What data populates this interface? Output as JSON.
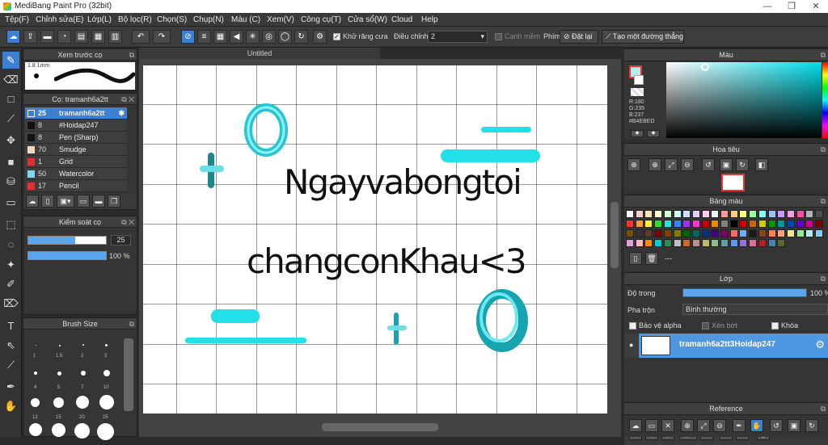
{
  "window": {
    "title": "MediBang Paint Pro (32bit)",
    "minimize": "—",
    "restore": "❐",
    "close": "✕"
  },
  "menu": [
    "Tệp(F)",
    "Chỉnh sửa(E)",
    "Lớp(L)",
    "Bộ lọc(R)",
    "Chọn(S)",
    "Chụp(N)",
    "Màu (C)",
    "Xem(V)",
    "Công cụ(T)",
    "Cửa sổ(W)",
    "Cloud",
    "Help"
  ],
  "toolbar": {
    "antialias": "Khử răng cưa",
    "adjust_label": "Điều chỉnh",
    "adjust_value": "2",
    "edge_snap": "Cạnh mềm",
    "snap_label": "Phím",
    "reset": "Đặt lại",
    "create_line": "Tạo một đường thẳng"
  },
  "brush_preview": {
    "title": "Xem trước cọ",
    "size": "1.8 1mm"
  },
  "brush_panel": {
    "title": "Cọ: tramanh6a2tt",
    "brushes": [
      {
        "num": "25",
        "name": "tramanh6a2tt",
        "color": "#3d7fd1"
      },
      {
        "num": "8",
        "name": "#Hoidap247",
        "color": "#111111"
      },
      {
        "num": "8",
        "name": "Pen (Sharp)",
        "color": "#111111"
      },
      {
        "num": "70",
        "name": "Smudge",
        "color": "#f4d7c0"
      },
      {
        "num": "1",
        "name": "Grid",
        "color": "#e03030"
      },
      {
        "num": "50",
        "name": "Watercolor",
        "color": "#7fd6f5"
      },
      {
        "num": "17",
        "name": "Pencil",
        "color": "#e03030"
      }
    ]
  },
  "brush_control": {
    "title": "Kiểm soát cọ",
    "size": "25",
    "opacity": "100 %",
    "size_frac": 0.6,
    "opacity_frac": 1.0
  },
  "brush_size": {
    "title": "Brush Size",
    "labels": [
      "1",
      "1.5",
      "2",
      "3",
      "4",
      "5",
      "7",
      "10",
      "12",
      "15",
      "20",
      "25"
    ]
  },
  "document": {
    "tab": "Untitled"
  },
  "canvas_text": {
    "line1": "Ngayvabongtoi",
    "line2": "changconKhau<3"
  },
  "color_panel": {
    "title": "Màu",
    "r": "R:180",
    "g": "G:235",
    "b": "B:237",
    "hex": "#B4EBED",
    "fg": "#b4ebed"
  },
  "navigator": {
    "title": "Hoa tiêu"
  },
  "palette": {
    "title": "Bảng màu",
    "extra": "---",
    "colors": [
      "#ffffff",
      "#ffcccc",
      "#ffe0b3",
      "#ffffcc",
      "#ccffcc",
      "#ccffff",
      "#cce0ff",
      "#e0ccff",
      "#ffccf0",
      "#f0f0f0",
      "#ff9999",
      "#ffcc80",
      "#ffff80",
      "#99ff99",
      "#80ffff",
      "#99c2ff",
      "#cc99ff",
      "#ff99e6",
      "#ff4da6",
      "#b3b3b3",
      "#4d4d4d",
      "#ff3333",
      "#ff9933",
      "#ffee33",
      "#33dd33",
      "#33dddd",
      "#3385ff",
      "#9933ff",
      "#ff33cc",
      "#cc0000",
      "#e68a00",
      "#808080",
      "#000000",
      "#cc0000",
      "#cc6600",
      "#cccc00",
      "#009900",
      "#009999",
      "#0047b3",
      "#6600cc",
      "#cc0099",
      "#800000",
      "#804d00",
      "#333333",
      "#5c3d2e",
      "#800000",
      "#804000",
      "#808000",
      "#006600",
      "#006666",
      "#003380",
      "#400080",
      "#800060",
      "#ff6666",
      "#66b3ff",
      "#1a1a1a",
      "#8b4513",
      "#ff7f50",
      "#ffa07a",
      "#f0e68c",
      "#90ee90",
      "#afeeee",
      "#87cefa",
      "#dda0dd",
      "#ffb6c1",
      "#ff8c00",
      "#00ced1",
      "#2e8b57",
      "#c0c0c0",
      "#d2691e",
      "#bc8f8f",
      "#bdb76b",
      "#8fbc8f",
      "#5f9ea0",
      "#6495ed",
      "#9370db",
      "#db7093",
      "#b22222",
      "#4682b4",
      "#556b2f"
    ]
  },
  "layer_panel": {
    "title": "Lớp",
    "opacity_label": "Độ trong",
    "opacity_value": "100 %",
    "opacity_frac": 1.0,
    "blend_label": "Pha trộn",
    "blend_value": "Bình thường",
    "protect_alpha": "Bảo vệ alpha",
    "clipping": "Xén bớt",
    "lock": "Khóa",
    "layer_name": "tramanh6a2tt3Hoidap247"
  },
  "reference": {
    "title": "Reference"
  }
}
